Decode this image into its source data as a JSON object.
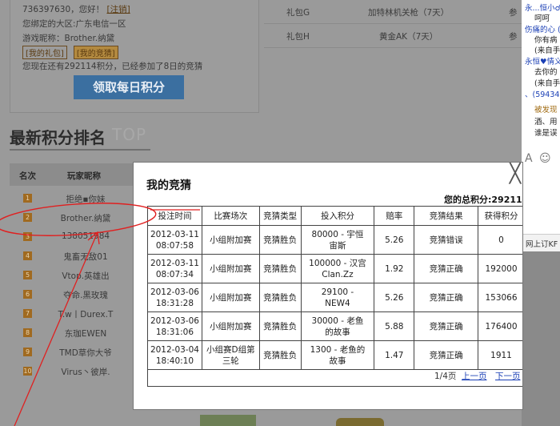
{
  "background": {
    "user_line": "736397630，您好！",
    "logout_link": "[注销]",
    "region_line": "您绑定的大区:广东电信一区",
    "game_name_line": "游戏昵称：Brother.纳黛",
    "tag_gifts": "[我的礼包]",
    "tag_guess": "[我的竞猜]",
    "points_line": "您现在还有292114积分，已经参加了8日的竞猜",
    "daily_button": "领取每日积分",
    "gift_rows": [
      {
        "name": "礼包G",
        "item": "加特林机关枪（7天）",
        "extra": "参"
      },
      {
        "name": "礼包H",
        "item": "黄金AK（7天）",
        "extra": "参"
      }
    ],
    "ranking_title": "最新积分排名",
    "ranking_top": "TOP",
    "ranking_headers": {
      "rank": "名次",
      "name": "玩家昵称"
    },
    "ranking_rows": [
      {
        "num": "1",
        "name": "拒绝▪你妹"
      },
      {
        "num": "2",
        "name": "Brother.纳黛"
      },
      {
        "num": "3",
        "name": "138051984"
      },
      {
        "num": "4",
        "name": "鬼畜无敌01"
      },
      {
        "num": "5",
        "name": "Vtop.英雄出"
      },
      {
        "num": "6",
        "name": "夺命.黑玫瑰"
      },
      {
        "num": "7",
        "name": "T.w丨Durex.T"
      },
      {
        "num": "8",
        "name": "东珈EWEN"
      },
      {
        "num": "9",
        "name": "TMD草你大爷"
      },
      {
        "num": "10",
        "name": "Virus丶彼岸."
      }
    ]
  },
  "chat": {
    "lines": [
      {
        "text": "永...恒小♂",
        "style": "blue"
      },
      {
        "text": "呵呵",
        "style": ""
      },
      {
        "text": "伤痛的心 (",
        "style": "blue"
      },
      {
        "text": "你有病",
        "style": ""
      },
      {
        "text": "(来自手",
        "style": ""
      },
      {
        "text": "永恒♥情义",
        "style": "blue"
      },
      {
        "text": "去你的",
        "style": ""
      },
      {
        "text": "(来自手",
        "style": ""
      },
      {
        "text": "、(59434",
        "style": "blue"
      },
      {
        "text": "被发现",
        "style": "gold"
      },
      {
        "text": "酒、用",
        "style": ""
      },
      {
        "text": "谁是误",
        "style": ""
      }
    ],
    "bottom_text": "网上订KF"
  },
  "modal": {
    "title": "我的竞猜",
    "total_label": "您的总积分:292114",
    "columns": [
      "投注时间",
      "比赛场次",
      "竞猜类型",
      "投入积分",
      "赔率",
      "竞猜结果",
      "获得积分"
    ],
    "rows": [
      {
        "date": "2012-03-11",
        "time": "08:07:58",
        "match": "小组附加赛",
        "type": "竞猜胜负",
        "bet_1": "80000 - 宇恒",
        "bet_2": "宙斯",
        "odds": "5.26",
        "result": "竞猜错误",
        "points": "0"
      },
      {
        "date": "2012-03-11",
        "time": "08:07:34",
        "match": "小组附加赛",
        "type": "竞猜胜负",
        "bet_1": "100000 - 汉宫",
        "bet_2": "Clan.Zz",
        "odds": "1.92",
        "result": "竞猜正确",
        "points": "192000"
      },
      {
        "date": "2012-03-06",
        "time": "18:31:28",
        "match": "小组附加赛",
        "type": "竞猜胜负",
        "bet_1": "29100 -",
        "bet_2": "NEW4",
        "odds": "5.26",
        "result": "竞猜正确",
        "points": "153066"
      },
      {
        "date": "2012-03-06",
        "time": "18:31:06",
        "match": "小组附加赛",
        "type": "竞猜胜负",
        "bet_1": "30000 - 老鱼",
        "bet_2": "的故事",
        "odds": "5.88",
        "result": "竞猜正确",
        "points": "176400"
      },
      {
        "date": "2012-03-04",
        "time": "18:40:10",
        "match_1": "小组赛D组第",
        "match_2": "三轮",
        "type": "竞猜胜负",
        "bet_1": "1300 - 老鱼的",
        "bet_2": "故事",
        "odds": "1.47",
        "result": "竞猜正确",
        "points": "1911"
      }
    ],
    "pager": {
      "page": "1/4页",
      "prev": "上一页",
      "next": "下一页"
    }
  },
  "colors": {
    "annotation": "#e02020",
    "link": "#1a3fb5"
  }
}
